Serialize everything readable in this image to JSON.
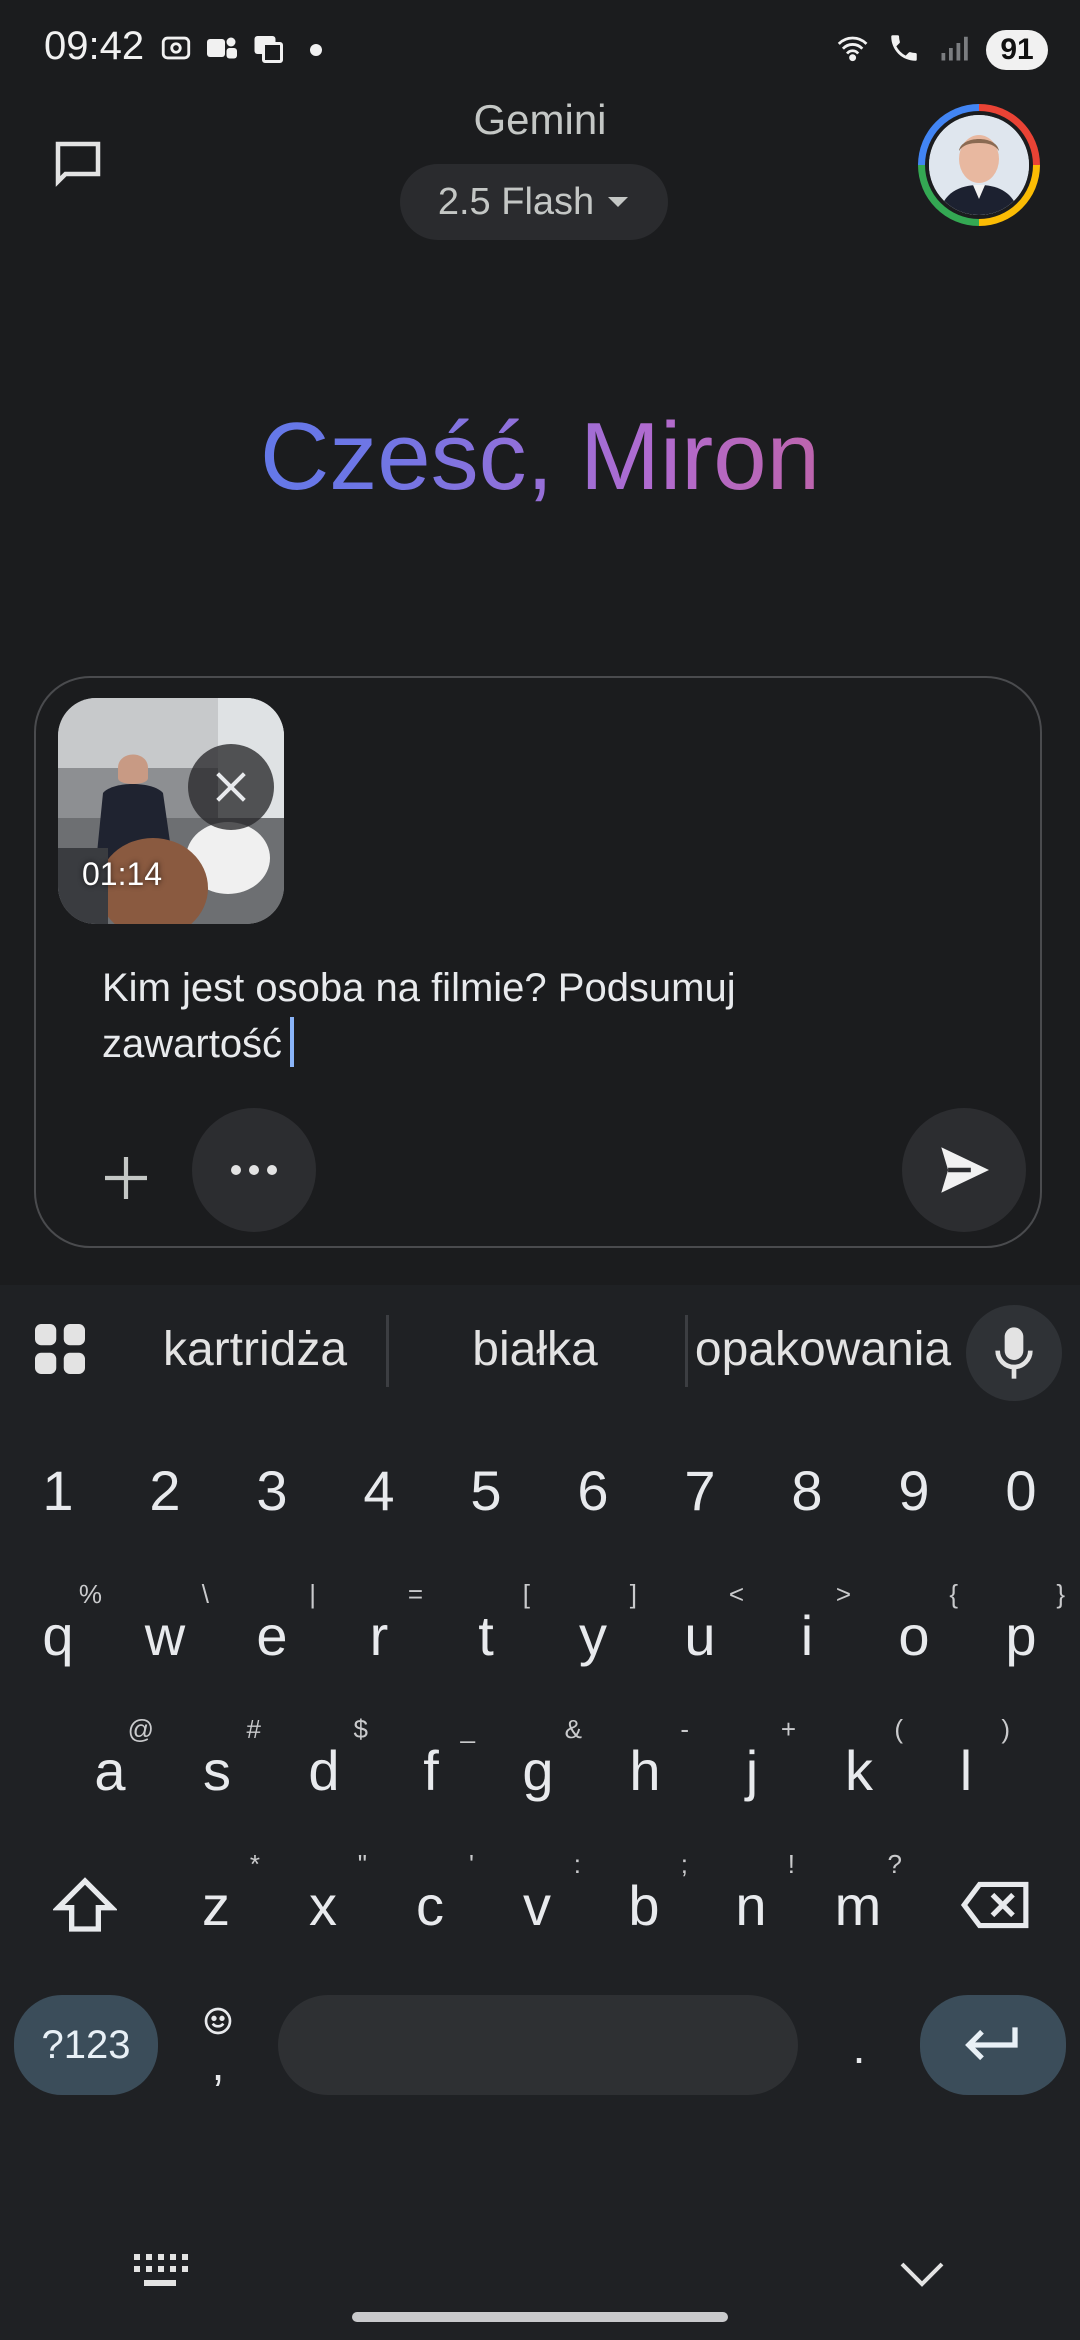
{
  "status_bar": {
    "time": "09:42",
    "battery": "91",
    "left_icons": [
      "screenshot-icon",
      "teams-icon",
      "work-profile-icon",
      "notification-dot-icon"
    ],
    "right_icons": [
      "wifi-calling-icon",
      "call-icon",
      "signal-icon"
    ]
  },
  "header": {
    "title": "Gemini",
    "model_label": "2.5 Flash",
    "new_chat_icon": "chat-bubble-icon",
    "avatar_icon": "user-avatar"
  },
  "greeting": "Cześć, Miron",
  "composer": {
    "attachment_duration": "01:14",
    "prompt_text": "Kim jest osoba na filmie? Podsumuj zawartość",
    "add_icon": "plus-icon",
    "more_icon": "more-horiz-icon",
    "send_icon": "send-icon"
  },
  "keyboard": {
    "suggestions": [
      "kartridża",
      "białka",
      "opakowania"
    ],
    "number_row": [
      "1",
      "2",
      "3",
      "4",
      "5",
      "6",
      "7",
      "8",
      "9",
      "0"
    ],
    "row1": [
      {
        "key": "q",
        "hint": "%"
      },
      {
        "key": "w",
        "hint": "\\"
      },
      {
        "key": "e",
        "hint": "|"
      },
      {
        "key": "r",
        "hint": "="
      },
      {
        "key": "t",
        "hint": "["
      },
      {
        "key": "y",
        "hint": "]"
      },
      {
        "key": "u",
        "hint": "<"
      },
      {
        "key": "i",
        "hint": ">"
      },
      {
        "key": "o",
        "hint": "{"
      },
      {
        "key": "p",
        "hint": "}"
      }
    ],
    "row2": [
      {
        "key": "a",
        "hint": "@"
      },
      {
        "key": "s",
        "hint": "#"
      },
      {
        "key": "d",
        "hint": "$"
      },
      {
        "key": "f",
        "hint": "_"
      },
      {
        "key": "g",
        "hint": "&"
      },
      {
        "key": "h",
        "hint": "-"
      },
      {
        "key": "j",
        "hint": "+"
      },
      {
        "key": "k",
        "hint": "("
      },
      {
        "key": "l",
        "hint": ")"
      }
    ],
    "row3": [
      {
        "key": "z",
        "hint": "*"
      },
      {
        "key": "x",
        "hint": "\""
      },
      {
        "key": "c",
        "hint": "'"
      },
      {
        "key": "v",
        "hint": ":"
      },
      {
        "key": "b",
        "hint": ";"
      },
      {
        "key": "n",
        "hint": "!"
      },
      {
        "key": "m",
        "hint": "?"
      }
    ],
    "symbols_key": "?123",
    "comma_key": ",",
    "period_key": ".",
    "colors": {
      "accent_key": "#3b4d5a",
      "background": "#1f2124"
    }
  }
}
